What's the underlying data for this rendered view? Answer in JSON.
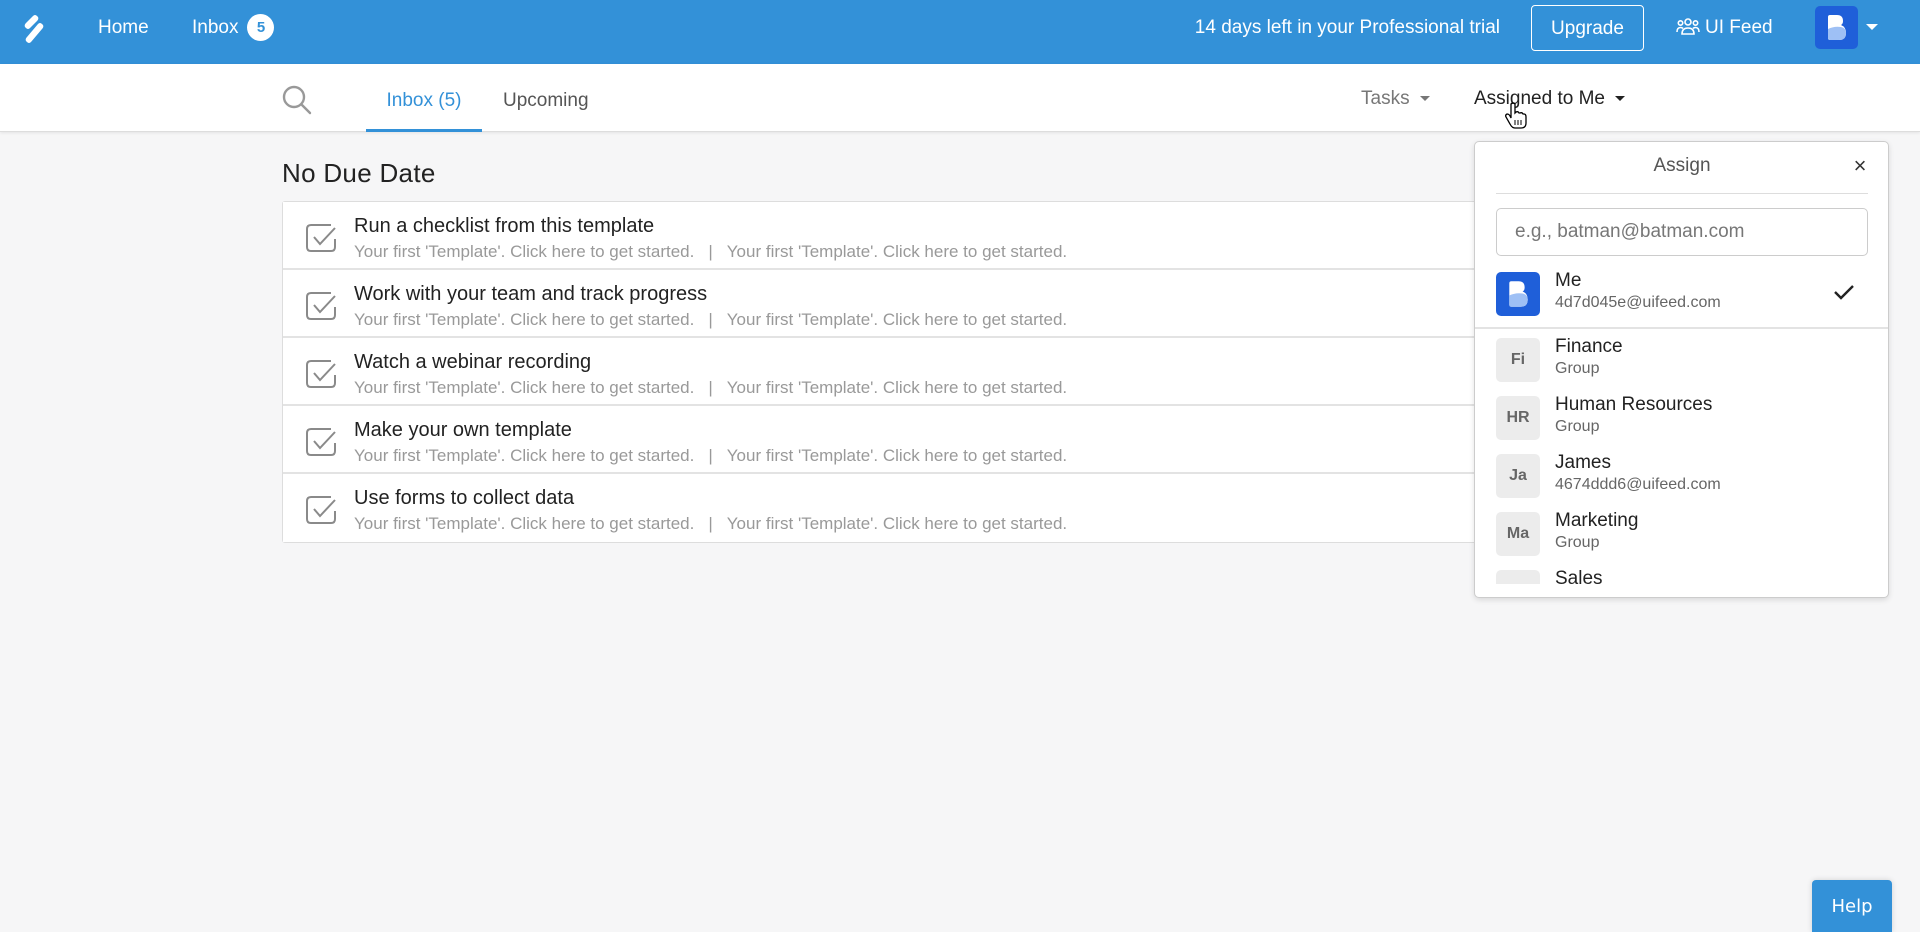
{
  "topnav": {
    "home_label": "Home",
    "inbox_label": "Inbox",
    "inbox_badge": "5",
    "trial_text": "14 days left in your Professional trial",
    "upgrade_label": "Upgrade",
    "feed_label": "UI Feed",
    "colors": {
      "brand": "#3391d8",
      "avatar": "#1f5fd9"
    }
  },
  "subnav": {
    "tabs": [
      {
        "label": "Inbox (5)",
        "active": true
      },
      {
        "label": "Upcoming",
        "active": false
      }
    ],
    "tasks_dropdown": "Tasks",
    "assigned_dropdown": "Assigned to Me"
  },
  "main": {
    "section_title": "No Due Date",
    "tasks": [
      {
        "title": "Run a checklist from this template",
        "left": "Your first 'Template'. Click here to get started.",
        "separator": "|",
        "right": "Your first 'Template'. Click here to get started."
      },
      {
        "title": "Work with your team and track progress",
        "left": "Your first 'Template'. Click here to get started.",
        "separator": "|",
        "right": "Your first 'Template'. Click here to get started."
      },
      {
        "title": "Watch a webinar recording",
        "left": "Your first 'Template'. Click here to get started.",
        "separator": "|",
        "right": "Your first 'Template'. Click here to get started."
      },
      {
        "title": "Make your own template",
        "left": "Your first 'Template'. Click here to get started.",
        "separator": "|",
        "right": "Your first 'Template'. Click here to get started."
      },
      {
        "title": "Use forms to collect data",
        "left": "Your first 'Template'. Click here to get started.",
        "separator": "|",
        "right": "Your first 'Template'. Click here to get started."
      }
    ]
  },
  "assign": {
    "title": "Assign",
    "close_glyph": "×",
    "search_placeholder": "e.g., batman@batman.com",
    "search_value": "",
    "me": {
      "name": "Me",
      "email": "4d7d045e@uifeed.com",
      "selected": true
    },
    "members": [
      {
        "initials": "Fi",
        "name": "Finance",
        "meta": "Group"
      },
      {
        "initials": "HR",
        "name": "Human Resources",
        "meta": "Group"
      },
      {
        "initials": "Ja",
        "name": "James",
        "meta": "4674ddd6@uifeed.com"
      },
      {
        "initials": "Ma",
        "name": "Marketing",
        "meta": "Group"
      },
      {
        "initials": "",
        "name": "Sales",
        "meta": ""
      }
    ]
  },
  "help_label": "Help"
}
